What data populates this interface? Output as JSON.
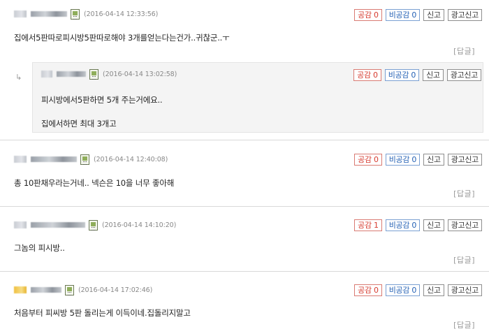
{
  "labels": {
    "reply": "[답글]",
    "reply_arrow": "↳"
  },
  "buttons": {
    "report": "신고",
    "ad_report": "광고신고"
  },
  "comments": [
    {
      "date": "(2016-04-14 12:33:56)",
      "like": "공감 0",
      "dislike": "비공감 0",
      "text": "집에서5판따로피시방5판따로해야 3개를얻는다는건가..귀찮군..ㅜ"
    },
    {
      "date": "(2016-04-14 13:02:58)",
      "like": "공감 0",
      "dislike": "비공감 0",
      "lines": [
        "피시방에서5판하면 5개 주는거에요..",
        "집에서하면 최대 3개고"
      ]
    },
    {
      "date": "(2016-04-14 12:40:08)",
      "like": "공감 0",
      "dislike": "비공감 0",
      "text": "총 10판채우라는거네.. 넥슨은 10을 너무 좋아해"
    },
    {
      "date": "(2016-04-14 14:10:20)",
      "like": "공감 1",
      "dislike": "비공감 0",
      "text": "그놈의 피시방.."
    },
    {
      "date": "(2016-04-14 17:02:46)",
      "like": "공감 0",
      "dislike": "비공감 0",
      "text": "처음부터 피씨방 5판 돌리는게 이득이네.집돌리지말고"
    }
  ],
  "colors": {
    "like": "#d63b2f",
    "dislike": "#2461b5",
    "separator": "#d9d9d9",
    "reply_bg": "#f4f4f4"
  }
}
